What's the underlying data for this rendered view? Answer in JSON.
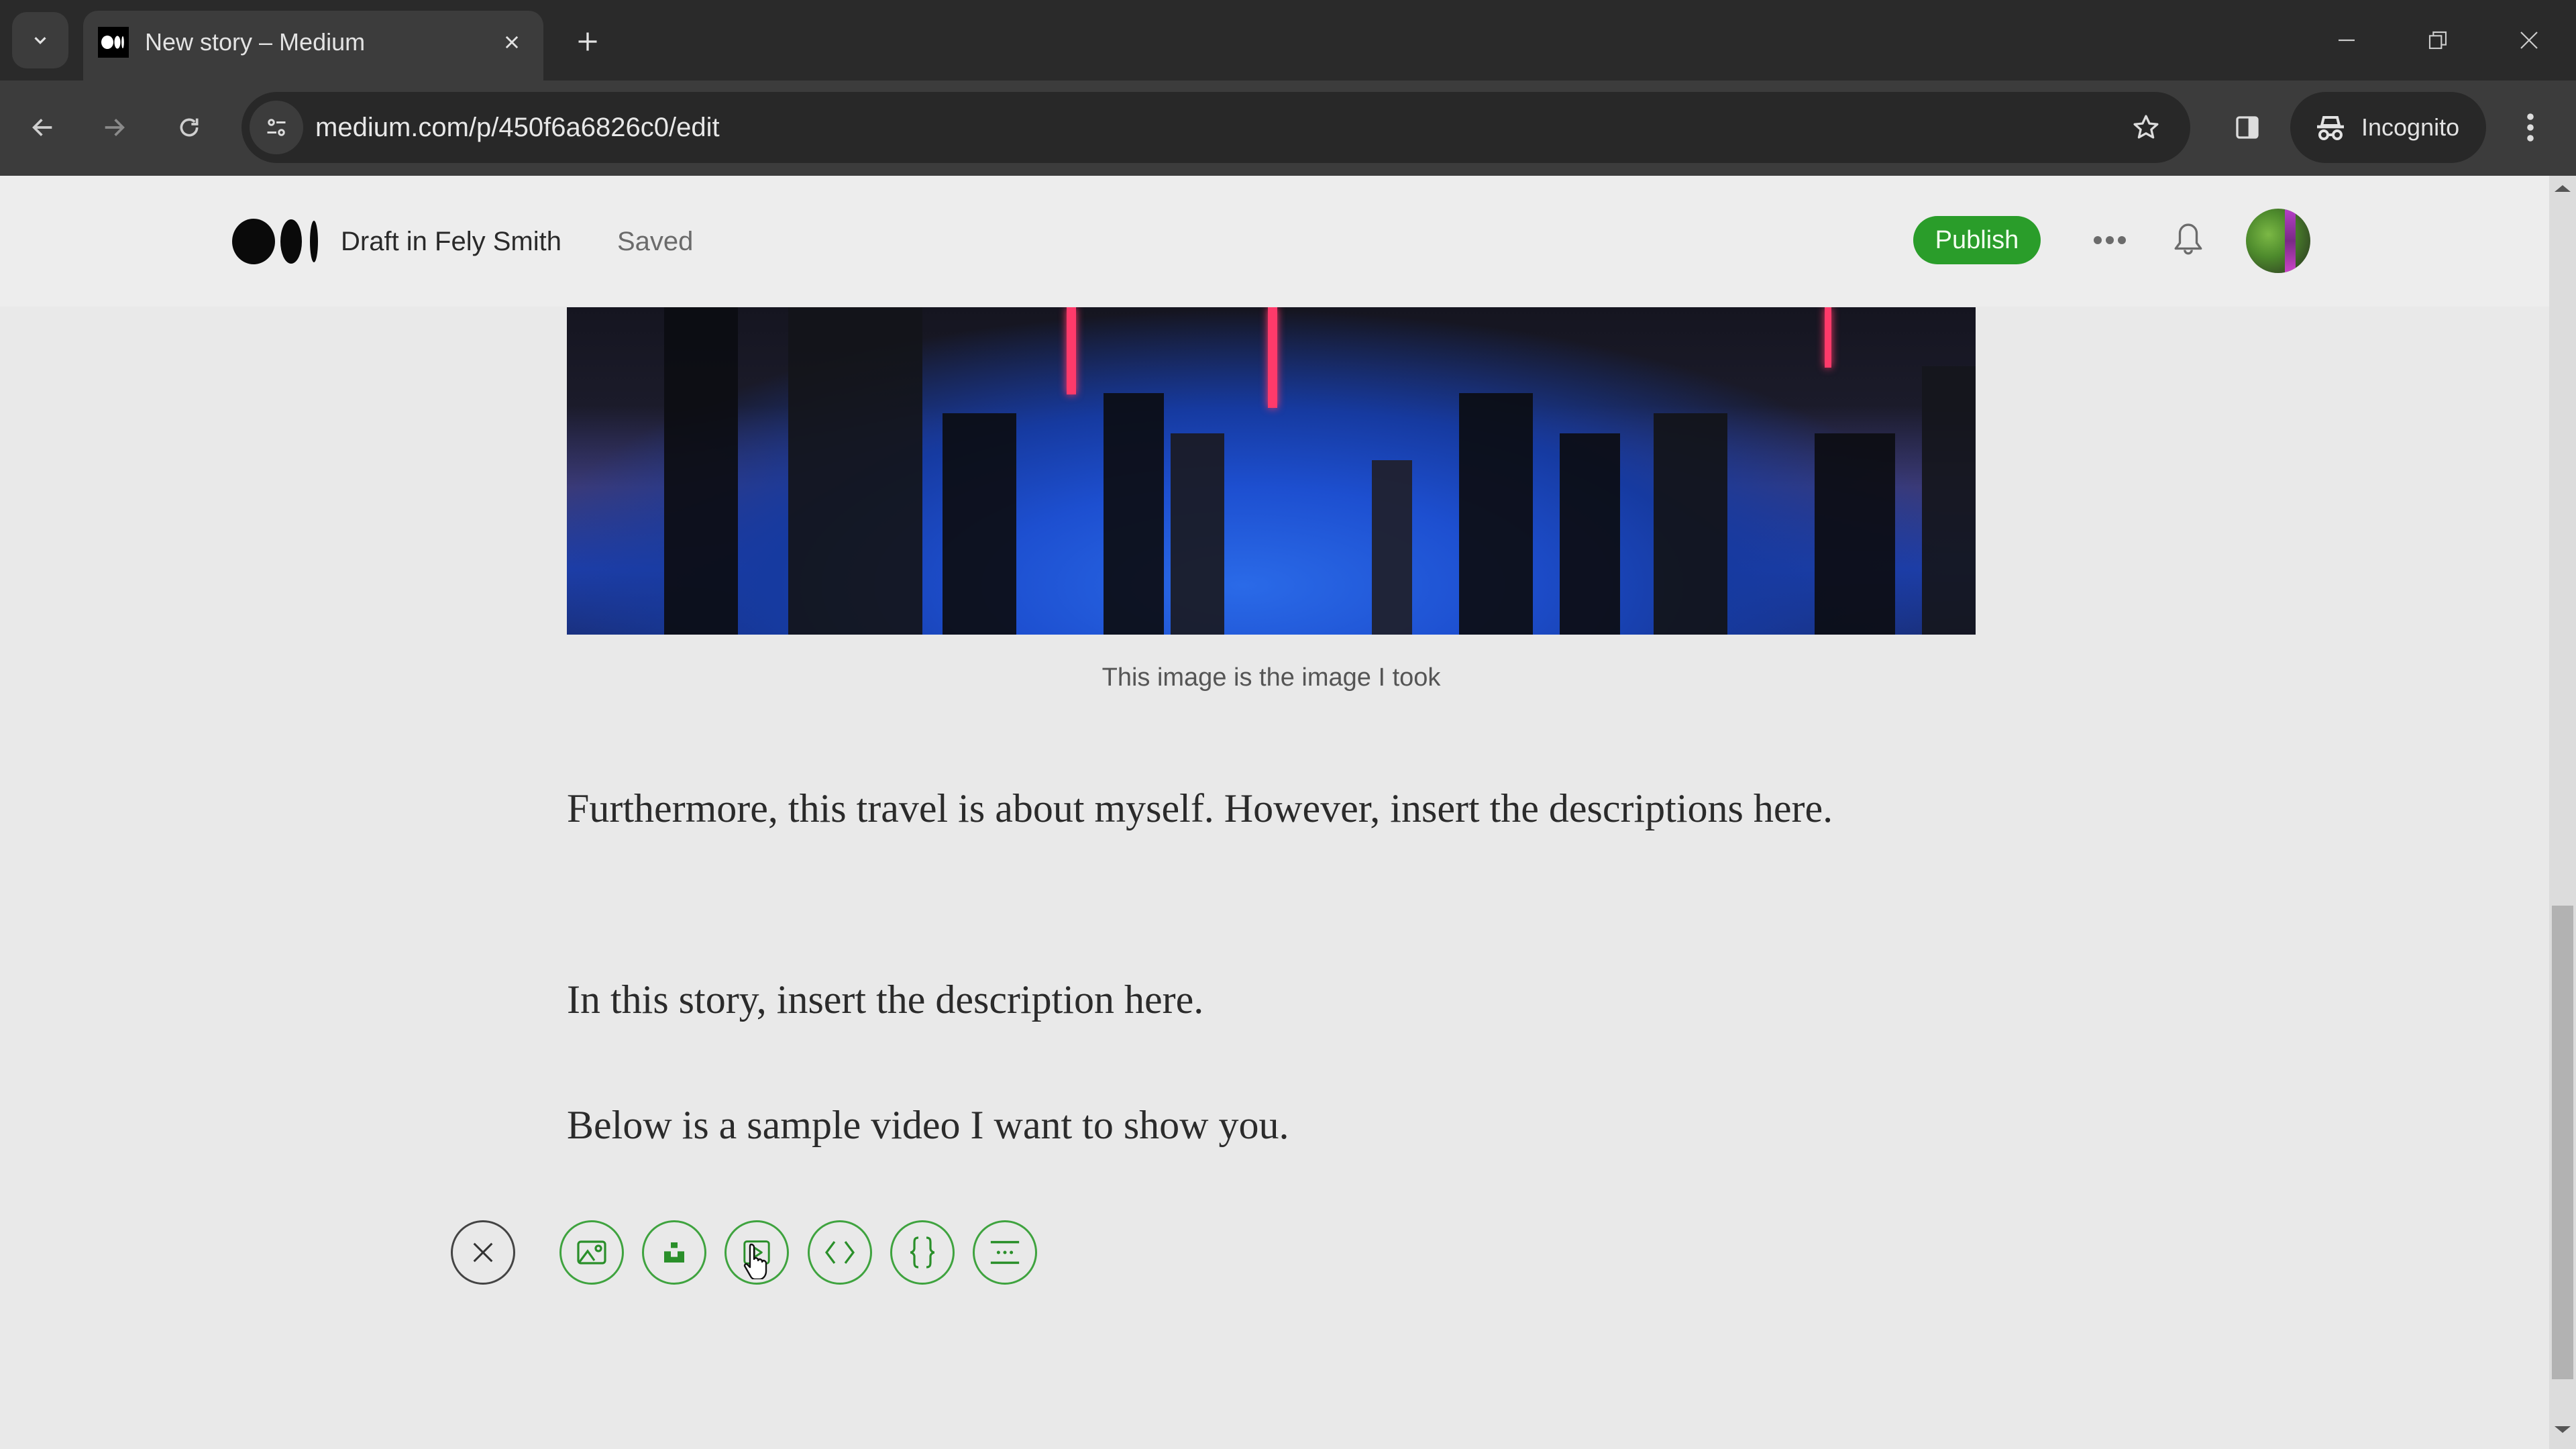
{
  "browser": {
    "tab": {
      "title": "New story – Medium",
      "favicon": "medium-logo-icon"
    },
    "url": "medium.com/p/450f6a6826c0/edit",
    "profile_label": "Incognito",
    "icons": {
      "tab_list": "chevron-down-icon",
      "close_tab": "close-icon",
      "new_tab": "plus-icon",
      "back": "arrow-left-icon",
      "forward": "arrow-right-icon",
      "reload": "reload-icon",
      "site_info": "tune-icon",
      "bookmark": "star-icon",
      "side_panel": "side-panel-icon",
      "incognito": "incognito-icon",
      "menu": "kebab-menu-icon",
      "minimize": "minimize-icon",
      "restore": "restore-icon",
      "close_window": "close-icon"
    }
  },
  "header": {
    "draft_label": "Draft in Fely Smith",
    "status": "Saved",
    "publish_label": "Publish",
    "accent_color": "#2a9d2a"
  },
  "story": {
    "image_caption": "This image is the image I took",
    "paragraphs": [
      "Furthermore, this travel is about myself. However, insert the descriptions here.",
      "In this story, insert the description here.",
      "Below is a sample video I want to show you."
    ]
  },
  "insert_toolbar": {
    "buttons": [
      {
        "name": "close",
        "icon": "close-icon"
      },
      {
        "name": "add-image",
        "icon": "image-icon"
      },
      {
        "name": "add-unsplash",
        "icon": "unsplash-icon"
      },
      {
        "name": "add-video",
        "icon": "video-icon"
      },
      {
        "name": "add-embed",
        "icon": "code-icon"
      },
      {
        "name": "add-code-block",
        "icon": "braces-icon"
      },
      {
        "name": "add-separator",
        "icon": "separator-icon"
      }
    ]
  },
  "scroll": {
    "position_fraction": 0.6
  }
}
